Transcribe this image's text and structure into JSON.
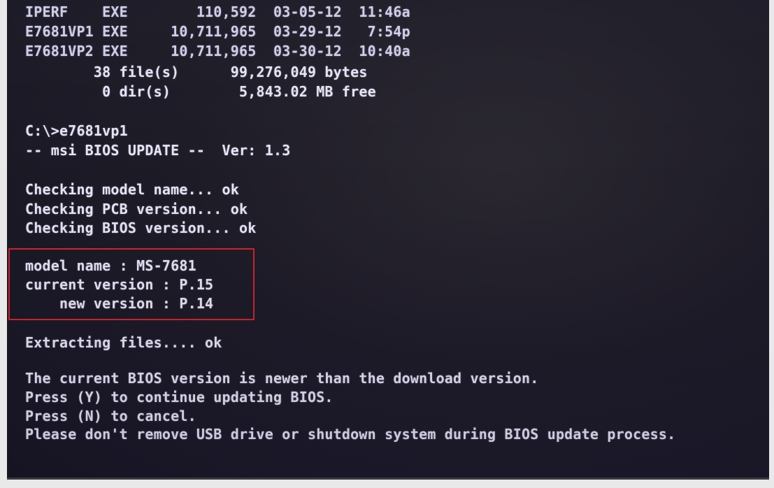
{
  "file_listing": [
    "IPERF    EXE        110,592  03-05-12  11:46a",
    "E7681VP1 EXE     10,711,965  03-29-12   7:54p",
    "E7681VP2 EXE     10,711,965  03-30-12  10:40a",
    "        38 file(s)      99,276,049 bytes",
    "         0 dir(s)        5,843.02 MB free"
  ],
  "command": "C:\\>e7681vp1",
  "banner": "-- msi BIOS UPDATE --  Ver: 1.3",
  "checks": [
    "Checking model name... ok",
    "Checking PCB version... ok",
    "Checking BIOS version... ok"
  ],
  "versions": {
    "model": "model name : MS-7681",
    "current": "current version : P.15",
    "new": "    new version : P.14"
  },
  "extracting": "Extracting files.... ok",
  "messages": [
    "The current BIOS version is newer than the download version.",
    "Press (Y) to continue updating BIOS.",
    "Press (N) to cancel.",
    "Please don't remove USB drive or shutdown system during BIOS update process."
  ],
  "colors": {
    "screen_bg": "#1b1a25",
    "text": "#e6e4f4",
    "highlight_border": "#d2232a"
  }
}
